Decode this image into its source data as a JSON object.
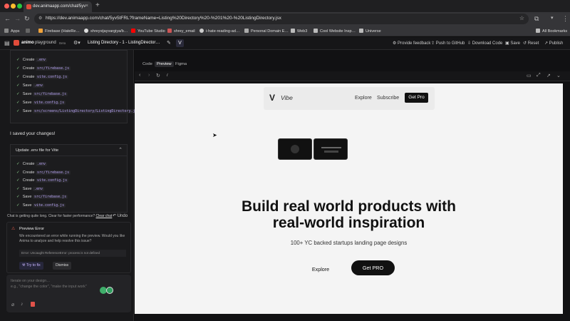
{
  "browser": {
    "tab_title": "dev.animaapp.com/chat/5yv",
    "url": "https://dev.animaapp.com/chat/5yv5tFRL?frameName=Listing%20Directory%20-%201%20-%20ListingDirectory.jsx",
    "bookmarks": [
      "Apps",
      "Firebase (HateRe…",
      "shreyvijayvargiya/b…",
      "YouTube Studio",
      "shrey_email",
      "i-hate-reading-ad…",
      "Personal Domain E…",
      "Web3",
      "Cool Website Insp…",
      "Universe"
    ],
    "all_bookmarks": "All Bookmarks",
    "colors": {
      "favicon": "#e04b3a",
      "youtube": "#ff0000"
    }
  },
  "app": {
    "logo_text": "animo",
    "product": "playground",
    "beta": "Beta",
    "frame_title": "Listing Directory - 1 - ListingDirector…",
    "actions": [
      "Provide feedback",
      "Push to GitHub",
      "Download Code",
      "Save",
      "Reset",
      "Publish"
    ]
  },
  "chat": {
    "card1_rows": [
      {
        "verb": "Create",
        "file": ".env"
      },
      {
        "verb": "Create",
        "file": "src/firebase.js"
      },
      {
        "verb": "Create",
        "file": "vite.config.js"
      },
      {
        "verb": "Save",
        "file": ".env"
      },
      {
        "verb": "Save",
        "file": "src/firebase.js"
      },
      {
        "verb": "Save",
        "file": "vite.config.js"
      },
      {
        "verb": "Save",
        "file": "src/screens/ListingDirectory/ListingDirectory.jsx"
      }
    ],
    "saved_message": "I saved your changes!",
    "card2_title": "Update .env file for Vite",
    "card2_rows": [
      {
        "verb": "Create",
        "file": ".env"
      },
      {
        "verb": "Create",
        "file": "src/firebase.js"
      },
      {
        "verb": "Create",
        "file": "vite.config.js"
      },
      {
        "verb": "Save",
        "file": ".env"
      },
      {
        "verb": "Save",
        "file": "src/firebase.js"
      },
      {
        "verb": "Save",
        "file": "vite.config.js"
      }
    ],
    "long_chat_note": "Chat is getting quite long. Clear for faster performance?",
    "clear_chat": "Clear chat",
    "undo": "Undo",
    "error_title": "Preview Error",
    "error_text": "We encountered an error while running the preview. Would you like Anima to analyze and help resolve this issue?",
    "error_code": "Error: Uncaught ReferenceError: process is not defined",
    "try_fix": "Try to fix",
    "dismiss": "Dismiss",
    "composer_placeholder_1": "Iterate on your design…",
    "composer_placeholder_2": "e.g., \"change the color\", \"make the input work\""
  },
  "editor": {
    "tabs": [
      "Code",
      "Preview",
      "Figma"
    ],
    "active_tab": "Preview",
    "path": "/"
  },
  "site": {
    "brand": "Vibe",
    "nav": [
      "Explore",
      "Subscribe"
    ],
    "nav_cta": "Get Pro",
    "headline_1": "Build real world products with",
    "headline_2": "real-world inspiration",
    "subheadline": "100+ YC backed startups landing page designs",
    "explore": "Explore",
    "get_pro": "Get PRO"
  }
}
